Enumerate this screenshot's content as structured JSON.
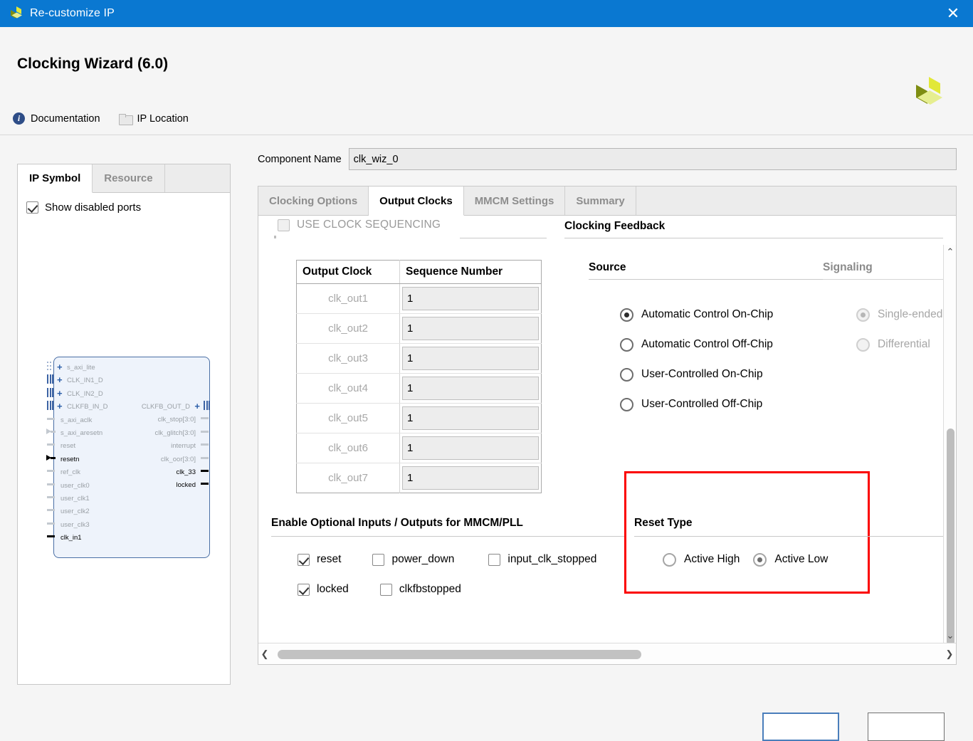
{
  "window": {
    "title": "Re-customize IP",
    "close_label": "✕",
    "logo_name": "xilinx-logo",
    "titlebar_color": "#0a78d1"
  },
  "header": {
    "page_title": "Clocking Wizard (6.0)",
    "links": [
      {
        "label": "Documentation",
        "icon": "info-icon"
      },
      {
        "label": "IP Location",
        "icon": "folder-icon"
      }
    ]
  },
  "left_panel": {
    "tabs": [
      {
        "label": "IP Symbol",
        "active": true
      },
      {
        "label": "Resource",
        "active": false
      }
    ],
    "show_disabled_ports": {
      "label": "Show disabled ports",
      "checked": true
    },
    "symbol": {
      "left_ports": [
        {
          "name": "s_axi_lite",
          "enabled": false,
          "bus": true,
          "plus": true,
          "connector": "bus-dotted"
        },
        {
          "name": "CLK_IN1_D",
          "enabled": false,
          "bus": true,
          "plus": true,
          "connector": "bus-solid"
        },
        {
          "name": "CLK_IN2_D",
          "enabled": false,
          "bus": true,
          "plus": true,
          "connector": "bus-solid"
        },
        {
          "name": "CLKFB_IN_D",
          "enabled": false,
          "bus": true,
          "plus": true,
          "connector": "bus-solid"
        },
        {
          "name": "s_axi_aclk",
          "enabled": false,
          "bus": false,
          "plus": false,
          "connector": "pin"
        },
        {
          "name": "s_axi_aresetn",
          "enabled": false,
          "bus": false,
          "plus": false,
          "connector": "arrow"
        },
        {
          "name": "reset",
          "enabled": false,
          "bus": false,
          "plus": false,
          "connector": "pin"
        },
        {
          "name": "resetn",
          "enabled": true,
          "bus": false,
          "plus": false,
          "connector": "arrow"
        },
        {
          "name": "ref_clk",
          "enabled": false,
          "bus": false,
          "plus": false,
          "connector": "pin"
        },
        {
          "name": "user_clk0",
          "enabled": false,
          "bus": false,
          "plus": false,
          "connector": "pin"
        },
        {
          "name": "user_clk1",
          "enabled": false,
          "bus": false,
          "plus": false,
          "connector": "pin"
        },
        {
          "name": "user_clk2",
          "enabled": false,
          "bus": false,
          "plus": false,
          "connector": "pin"
        },
        {
          "name": "user_clk3",
          "enabled": false,
          "bus": false,
          "plus": false,
          "connector": "pin"
        },
        {
          "name": "clk_in1",
          "enabled": true,
          "bus": false,
          "plus": false,
          "connector": "pin"
        }
      ],
      "right_ports": [
        {
          "name": "CLKFB_OUT_D",
          "enabled": false,
          "bus": true,
          "plus": true,
          "connector": "bus-solid"
        },
        {
          "name": "clk_stop[3:0]",
          "enabled": false,
          "bus": false,
          "plus": false,
          "connector": "pin"
        },
        {
          "name": "clk_glitch[3:0]",
          "enabled": false,
          "bus": false,
          "plus": false,
          "connector": "pin"
        },
        {
          "name": "interrupt",
          "enabled": false,
          "bus": false,
          "plus": false,
          "connector": "pin"
        },
        {
          "name": "clk_oor[3:0]",
          "enabled": false,
          "bus": false,
          "plus": false,
          "connector": "pin"
        },
        {
          "name": "clk_33",
          "enabled": true,
          "bus": false,
          "plus": false,
          "connector": "pin"
        },
        {
          "name": "locked",
          "enabled": true,
          "bus": false,
          "plus": false,
          "connector": "pin"
        }
      ]
    }
  },
  "main": {
    "component_name": {
      "label": "Component Name",
      "value": "clk_wiz_0"
    },
    "tabs": [
      {
        "label": "Clocking Options",
        "active": false
      },
      {
        "label": "Output Clocks",
        "active": true
      },
      {
        "label": "MMCM Settings",
        "active": false
      },
      {
        "label": "Summary",
        "active": false
      }
    ],
    "use_clock_sequencing": {
      "label": "USE CLOCK SEQUENCING",
      "checked": false,
      "enabled": false
    },
    "sequence_table": {
      "headers": [
        "Output Clock",
        "Sequence Number"
      ],
      "rows": [
        {
          "clock": "clk_out1",
          "sequence": "1"
        },
        {
          "clock": "clk_out2",
          "sequence": "1"
        },
        {
          "clock": "clk_out3",
          "sequence": "1"
        },
        {
          "clock": "clk_out4",
          "sequence": "1"
        },
        {
          "clock": "clk_out5",
          "sequence": "1"
        },
        {
          "clock": "clk_out6",
          "sequence": "1"
        },
        {
          "clock": "clk_out7",
          "sequence": "1"
        }
      ]
    },
    "clocking_feedback": {
      "title": "Clocking Feedback",
      "source": {
        "title": "Source",
        "options": [
          {
            "label": "Automatic Control On-Chip",
            "selected": true,
            "enabled": true
          },
          {
            "label": "Automatic Control Off-Chip",
            "selected": false,
            "enabled": true
          },
          {
            "label": "User-Controlled On-Chip",
            "selected": false,
            "enabled": true
          },
          {
            "label": "User-Controlled Off-Chip",
            "selected": false,
            "enabled": true
          }
        ]
      },
      "signaling": {
        "title": "Signaling",
        "options": [
          {
            "label": "Single-ended",
            "selected": true,
            "enabled": false
          },
          {
            "label": "Differential",
            "selected": false,
            "enabled": false
          }
        ]
      }
    },
    "optional_io": {
      "title": "Enable Optional Inputs / Outputs for MMCM/PLL",
      "rows": [
        [
          {
            "label": "reset",
            "checked": true
          },
          {
            "label": "power_down",
            "checked": false
          },
          {
            "label": "input_clk_stopped",
            "checked": false
          }
        ],
        [
          {
            "label": "locked",
            "checked": true
          },
          {
            "label": "clkfbstopped",
            "checked": false
          }
        ]
      ]
    },
    "reset_type": {
      "title": "Reset Type",
      "highlight_color": "#fb0000",
      "options": [
        {
          "label": "Active High",
          "selected": false
        },
        {
          "label": "Active Low",
          "selected": true
        }
      ]
    },
    "scrollbars": {
      "vertical": {
        "up_glyph": "⌃",
        "down_glyph": "⌄"
      },
      "horizontal": {
        "left_glyph": "❮",
        "right_glyph": "❯"
      }
    }
  }
}
